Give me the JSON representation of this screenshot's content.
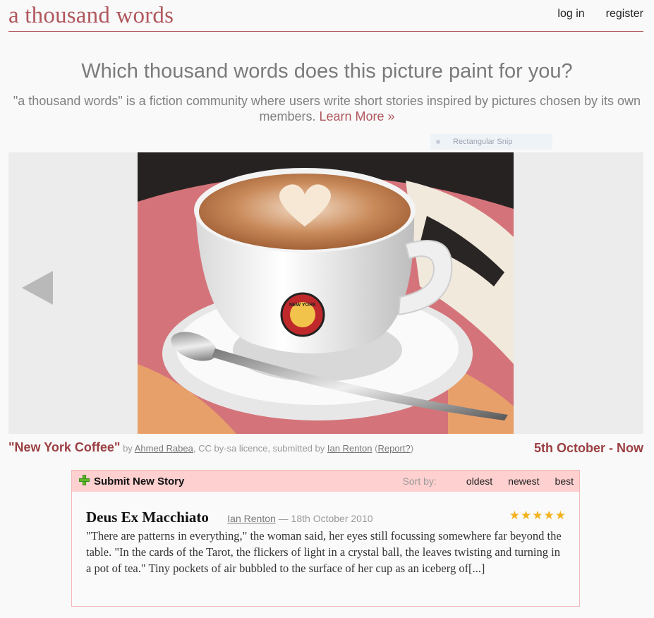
{
  "header": {
    "site_title": "a thousand words",
    "nav": {
      "login": "log in",
      "register": "register"
    }
  },
  "intro": {
    "headline": "Which thousand words does this picture paint for you?",
    "description": "\"a thousand words\" is a fiction community where users write short stories inspired by pictures chosen by its own members.",
    "learn_more": "Learn More »"
  },
  "overlay": {
    "snip_label": "Rectangular Snip"
  },
  "picture": {
    "title": "\"New York Coffee\"",
    "by": "by",
    "author": "Ahmed Rabea",
    "licence": ", CC by-sa licence, submitted by",
    "submitter": "Ian Renton",
    "report_open": "(",
    "report": "Report?",
    "report_close": ")",
    "date_range": "5th October - Now",
    "cup_brand": "NEW YORK"
  },
  "stories": {
    "submit_label": "Submit New Story",
    "sort_label": "Sort by:",
    "sort_options": [
      "oldest",
      "newest",
      "best"
    ],
    "items": [
      {
        "title": "Deus Ex Macchiato",
        "author": "Ian Renton",
        "date": " — 18th October 2010",
        "rating": 5,
        "excerpt": "\"There are patterns in everything,\" the woman said, her eyes still focussing somewhere far beyond the table. \"In the cards of the Tarot, the flickers of light in a crystal ball, the leaves twisting and turning in a pot of tea.\" Tiny pockets of air bubbled to the surface of her cup as an iceberg of[...]"
      }
    ]
  },
  "colors": {
    "accent": "#b0575d",
    "title_red": "#9b3f42",
    "panel_bar": "#ffd0d0",
    "star": "#f3b21d"
  }
}
